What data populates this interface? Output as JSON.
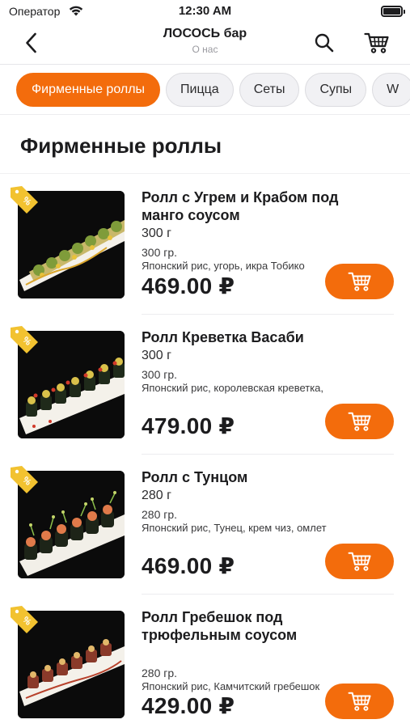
{
  "status_bar": {
    "carrier": "Оператор",
    "time": "12:30 AM"
  },
  "header": {
    "title": "ЛОСОСЬ бар",
    "subtitle": "О нас"
  },
  "tabs": [
    {
      "label": "Фирменные роллы",
      "active": true
    },
    {
      "label": "Пицца",
      "active": false
    },
    {
      "label": "Сеты",
      "active": false
    },
    {
      "label": "Супы",
      "active": false
    },
    {
      "label": "W",
      "active": false
    }
  ],
  "section_title": "Фирменные роллы",
  "products": [
    {
      "name": "Ролл с Угрем и Крабом под манго соусом",
      "weight": "300 г",
      "weight_small": "300 гр.",
      "description": "Японский рис, угорь, икра Тобико",
      "price": "469.00 ₽"
    },
    {
      "name": "Ролл Креветка Васаби",
      "weight": "300 г",
      "weight_small": "300 гр.",
      "description": "Японский рис, королевская креветка,",
      "price": "479.00 ₽"
    },
    {
      "name": "Ролл с Тунцом",
      "weight": "280 г",
      "weight_small": "280 гр.",
      "description": "Японский рис, Тунец, крем чиз, омлет",
      "price": "469.00 ₽"
    },
    {
      "name": "Ролл Гребешок под трюфельным соусом",
      "weight": "",
      "weight_small": "280 гр.",
      "description": "Японский рис, Камчитский гребешок",
      "price": "429.00 ₽"
    }
  ],
  "icons": {
    "back": "chevron-left-icon",
    "search": "search-icon",
    "cart": "cart-icon",
    "promo": "discount-tag-icon",
    "add_to_cart": "cart-icon"
  },
  "colors": {
    "accent": "#f36c0c",
    "promo_tag": "#f2c230"
  }
}
